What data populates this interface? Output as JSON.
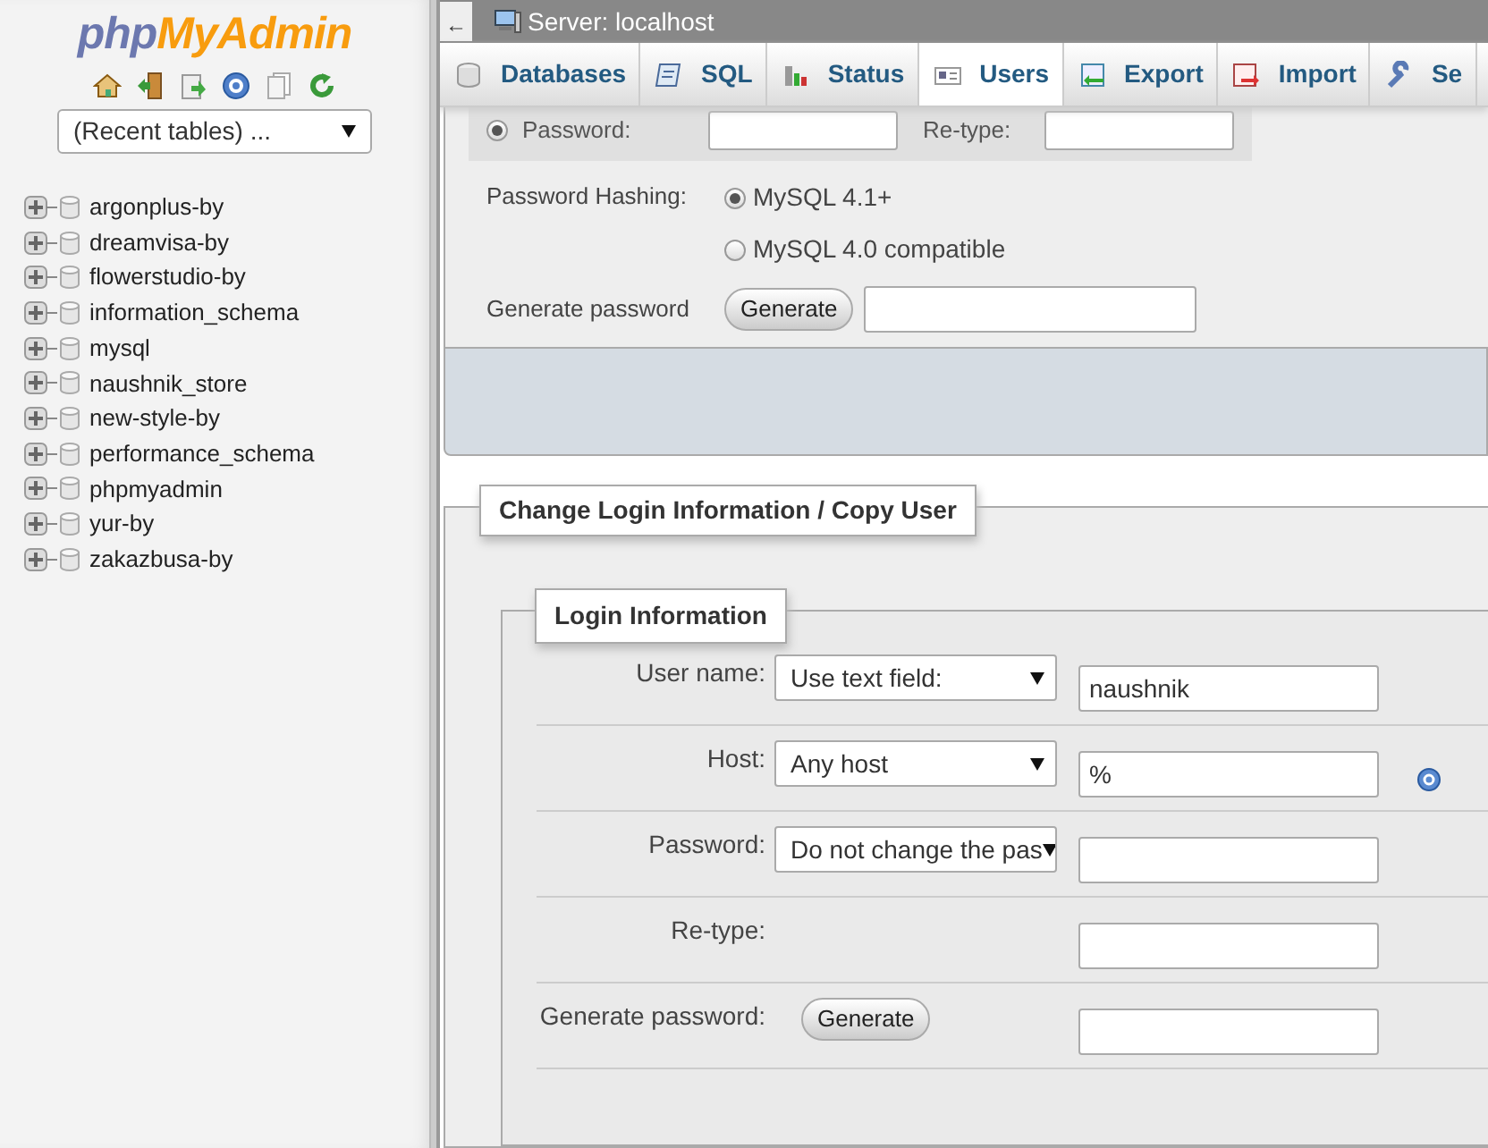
{
  "logo": {
    "prefix": "php",
    "name": "MyAdmin"
  },
  "recent_tables": {
    "value": "(Recent tables) ..."
  },
  "databases": [
    {
      "name": "argonplus-by",
      "expanded": false
    },
    {
      "name": "dreamvisa-by",
      "expanded": false
    },
    {
      "name": "flowerstudio-by",
      "expanded": false
    },
    {
      "name": "information_schema",
      "expanded": false
    },
    {
      "name": "mysql",
      "expanded": false
    },
    {
      "name": "naushnik_store",
      "expanded": false
    },
    {
      "name": "new-style-by",
      "expanded": false
    },
    {
      "name": "performance_schema",
      "expanded": false
    },
    {
      "name": "phpmyadmin",
      "expanded": false
    },
    {
      "name": "yur-by",
      "expanded": false
    },
    {
      "name": "zakazbusa-by",
      "expanded": false
    }
  ],
  "top_bar": {
    "back": "←",
    "title": "Server: localhost"
  },
  "tabs": [
    {
      "label": "Databases",
      "kind": "db",
      "selected": false
    },
    {
      "label": "SQL",
      "kind": "sql",
      "selected": false
    },
    {
      "label": "Status",
      "kind": "status",
      "selected": false
    },
    {
      "label": "Users",
      "kind": "users",
      "selected": true
    },
    {
      "label": "Export",
      "kind": "export",
      "selected": false
    },
    {
      "label": "Import",
      "kind": "import",
      "selected": false
    },
    {
      "label": "Se",
      "kind": "settings",
      "selected": false
    }
  ],
  "password_form": {
    "password_label": "Password:",
    "password_checked": true,
    "retype_label": "Re-type:",
    "hashing_label": "Password Hashing:",
    "hashing_options": [
      {
        "label": "MySQL 4.1+",
        "selected": true
      },
      {
        "label": "MySQL 4.0 compatible",
        "selected": false
      }
    ],
    "generate_label": "Generate password",
    "generate_button": "Generate"
  },
  "change_login": {
    "legend": "Change Login Information / Copy User",
    "inner_legend": "Login Information",
    "rows": [
      {
        "kind": "select-input",
        "label": "User name:",
        "select": "Use text field:",
        "value": "naushnik",
        "help": false
      },
      {
        "kind": "select-input",
        "label": "Host:",
        "select": "Any host",
        "value": "%",
        "help": true
      },
      {
        "kind": "select-input",
        "label": "Password:",
        "select": "Do not change the pas",
        "value": "",
        "help": false
      },
      {
        "kind": "input",
        "label": "Re-type:",
        "help": false
      },
      {
        "kind": "button-input",
        "label": "Generate password:",
        "button": "Generate",
        "help": false
      }
    ]
  }
}
